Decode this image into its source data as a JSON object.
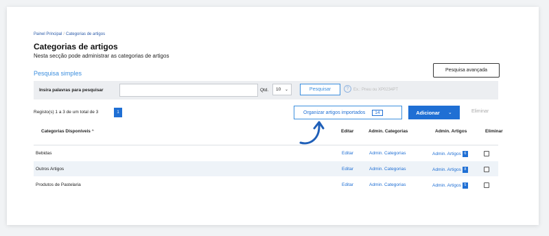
{
  "breadcrumb": {
    "home": "Painel Principal",
    "separator": "/",
    "current": "Categorias de artigos"
  },
  "page": {
    "title": "Categorias de artigos",
    "subtitle": "Nesta secção pode administrar as categorias de artigos"
  },
  "advanced_search": "Pesquisa avançada",
  "simple_search": {
    "title": "Pesquisa simples",
    "label": "Insira palavras para pesquisar",
    "input_value": "",
    "qtd_label": "Qtd.",
    "qtd_value": "10",
    "search_button": "Pesquisar",
    "hint": "Ex.: Pneu ou XP0234PT"
  },
  "toolbar": {
    "records": "Registo(s) 1 a 3 de um total de 3",
    "page": "1",
    "organize_label": "Organizar artigos importados",
    "organize_count": "14",
    "add_label": "Adicionar",
    "delete_label": "Eliminar"
  },
  "table": {
    "headers": {
      "name": "Categorias Disponíveis",
      "sort": "^",
      "edit": "Editar",
      "admin_cat": "Admin. Categorias",
      "admin_art": "Admin. Artigos",
      "delete": "Eliminar"
    },
    "rows": [
      {
        "name": "Bebidas",
        "edit": "Editar",
        "admin_cat": "Admin. Categorias",
        "admin_art": "Admin. Artigos",
        "count": "6"
      },
      {
        "name": "Outros Artigos",
        "edit": "Editar",
        "admin_cat": "Admin. Categorias",
        "admin_art": "Admin. Artigos",
        "count": "8"
      },
      {
        "name": "Produtos de Pastelaria",
        "edit": "Editar",
        "admin_cat": "Admin. Categorias",
        "admin_art": "Admin. Artigos",
        "count": "5"
      }
    ]
  },
  "colors": {
    "accent": "#1f6fd4",
    "link": "#3b8ede"
  }
}
